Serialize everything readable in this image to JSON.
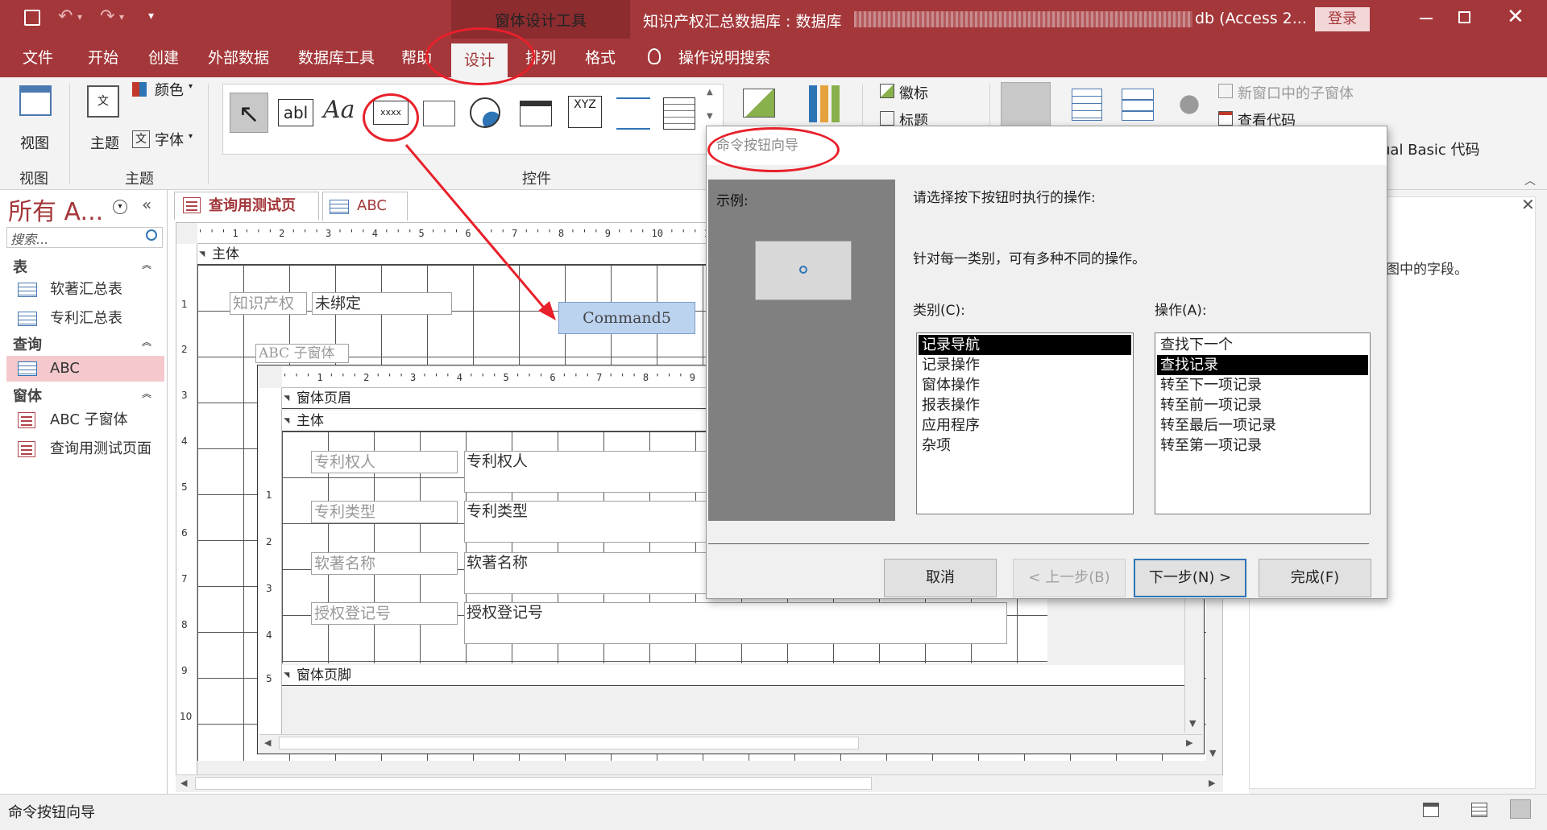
{
  "titlebar": {
    "context_tab": "窗体设计工具",
    "title": "知识产权汇总数据库 : 数据库",
    "title_suffix": "db (Access 2...",
    "login": "登录",
    "quick_access": [
      "save-icon",
      "undo-icon",
      "redo-icon",
      "customize-icon"
    ],
    "window_buttons": [
      "minimize-icon",
      "restore-icon",
      "close-icon"
    ]
  },
  "tabs": [
    "文件",
    "开始",
    "创建",
    "外部数据",
    "数据库工具",
    "帮助",
    "设计",
    "排列",
    "格式"
  ],
  "tell_me": "操作说明搜索",
  "ribbon": {
    "view_label": "视图",
    "view_group": "视图",
    "theme_label": "主题",
    "colors_label": "颜色",
    "fonts_label": "字体",
    "theme_group": "主题",
    "controls_group": "控件",
    "logo_label": "徽标",
    "title_label": "标题",
    "subform_new_window": "新窗口中的子窗体",
    "view_code": "查看代码",
    "vba_fragment": "ual Basic 代码",
    "textbox_glyph": "abl",
    "label_glyph": "Aa",
    "button_glyph": "xxxx",
    "option_glyph": "XYZ"
  },
  "nav": {
    "header": "所有 A...",
    "search_placeholder": "搜索...",
    "sections": [
      {
        "title": "表",
        "items": [
          "软著汇总表",
          "专利汇总表"
        ]
      },
      {
        "title": "查询",
        "items": [
          "ABC"
        ]
      },
      {
        "title": "窗体",
        "items": [
          "ABC 子窗体",
          "查询用测试页面"
        ]
      }
    ]
  },
  "doc_tabs": [
    "查询用测试页面",
    "ABC"
  ],
  "form": {
    "section_body": "主体",
    "label_ip": "知识产权",
    "unbound": "未绑定",
    "command_button": "Command5",
    "subform_label": "ABC 子窗体",
    "sub_header": "窗体页眉",
    "sub_body": "主体",
    "fields": [
      {
        "label": "专利权人",
        "value": "专利权人"
      },
      {
        "label": "专利类型",
        "value": "专利类型"
      },
      {
        "label": "软著名称",
        "value": "软著名称"
      },
      {
        "label": "授权登记号",
        "value": "授权登记号"
      }
    ],
    "sub_footer": "窗体页脚",
    "ruler_h": "' ' ' 1 ' ' ' 2 ' ' ' 3 ' ' ' 4 ' ' ' 5 ' ' ' 6 ' ' ' 7 ' ' ' 8 ' ' ' 9 ' ' ' 10 ' ' ' 1",
    "ruler_h_sub": "' ' ' 1 ' ' ' 2 ' ' ' 3 ' ' ' 4 ' ' ' 5 ' ' ' 6 ' ' ' 7 ' ' ' 8 ' ' ' 9",
    "ruler_v": [
      "1",
      "2",
      "3",
      "4",
      "5",
      "6",
      "7",
      "8",
      "9",
      "10"
    ],
    "ruler_v_sub": [
      "1",
      "2",
      "3",
      "4",
      "5"
    ]
  },
  "dialog": {
    "title": "命令按钮向导",
    "example_label": "示例:",
    "prompt": "请选择按下按钮时执行的操作:",
    "hint": "针对每一类别，可有多种不同的操作。",
    "category_label": "类别(C):",
    "action_label": "操作(A):",
    "categories": [
      "记录导航",
      "记录操作",
      "窗体操作",
      "报表操作",
      "应用程序",
      "杂项"
    ],
    "selected_category": 0,
    "actions": [
      "查找下一个",
      "查找记录",
      "转至下一项记录",
      "转至前一项记录",
      "转至最后一项记录",
      "转至第一项记录"
    ],
    "selected_action": 1,
    "buttons": {
      "cancel": "取消",
      "back": "< 上一步(B)",
      "next": "下一步(N) >",
      "finish": "完成(F)"
    }
  },
  "right_pane": {
    "text_fragment": "图中的字段。"
  },
  "status": {
    "text": "命令按钮向导"
  }
}
